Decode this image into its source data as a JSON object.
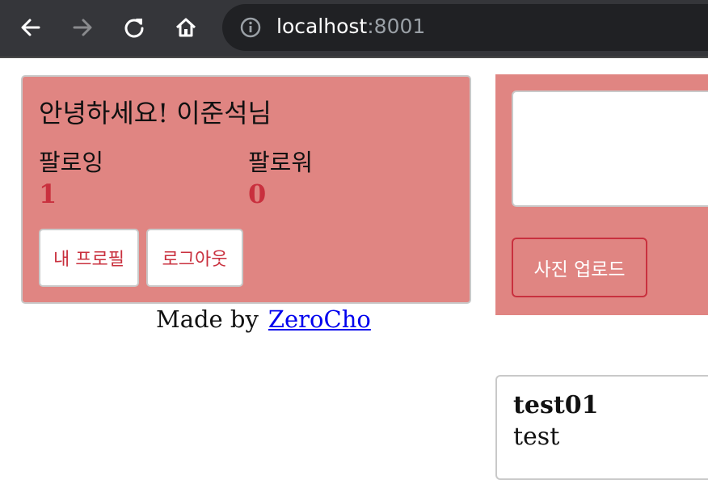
{
  "browser": {
    "url_host": "localhost",
    "url_port": ":8001",
    "icons": [
      "back-icon",
      "forward-icon",
      "reload-icon",
      "home-icon",
      "info-icon"
    ]
  },
  "profile": {
    "greeting": "안녕하세요! 이준석님",
    "following_label": "팔로잉",
    "following_count": "1",
    "followers_label": "팔로워",
    "followers_count": "0",
    "my_profile_label": "내 프로필",
    "logout_label": "로그아웃"
  },
  "footer": {
    "made_by": "Made by",
    "author": "ZeroCho"
  },
  "tweet_form": {
    "textarea_value": "",
    "upload_label": "사진 업로드"
  },
  "tweets": [
    {
      "user": "test01",
      "content": "test"
    }
  ],
  "colors": {
    "card_bg": "#e08582",
    "accent": "#c9303e",
    "chrome_bg": "#35363a"
  }
}
